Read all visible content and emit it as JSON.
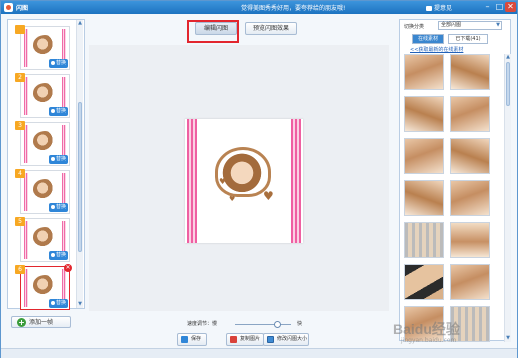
{
  "titlebar": {
    "app_title": "闪图",
    "promo": "觉得美图秀秀好用，要夸荐给的朋友哦!",
    "feedback": "提意见",
    "min": "–",
    "max": "□",
    "close": "✕"
  },
  "frames": {
    "items": [
      {
        "num": "",
        "swap_label": "替换"
      },
      {
        "num": "2",
        "swap_label": "替换"
      },
      {
        "num": "3",
        "swap_label": "替换"
      },
      {
        "num": "4",
        "swap_label": "替换"
      },
      {
        "num": "5",
        "swap_label": "替换"
      },
      {
        "num": "6",
        "swap_label": "替换"
      }
    ],
    "add_label": "添加一帧",
    "delete_glyph": "✕",
    "scroll_up": "▲",
    "scroll_down": "▼"
  },
  "center": {
    "tab_edit": "编辑闪图",
    "tab_preview": "预览闪图效果",
    "speed_label": "速度调节：慢",
    "speed_fast": "快",
    "speed_value": 0.75,
    "save_label": "保存",
    "copy_label": "复制图片",
    "resize_label": "修改闪图大小"
  },
  "right": {
    "switch_label": "切换分类",
    "category": "全部闪图",
    "dropdown_glyph": "▼",
    "tab_online": "在线素材",
    "tab_downloaded": "已下载(41)",
    "get_more": "<<获取最新的在线素材",
    "scroll_up": "▲",
    "scroll_down": "▼"
  },
  "watermark": {
    "text": "Baidu经验",
    "sub": "jingyan.baidu.com"
  },
  "colors": {
    "titlebar": "#1d73c0",
    "accent_red": "#e2262e",
    "pink_stripe": "#ef5fa2"
  }
}
